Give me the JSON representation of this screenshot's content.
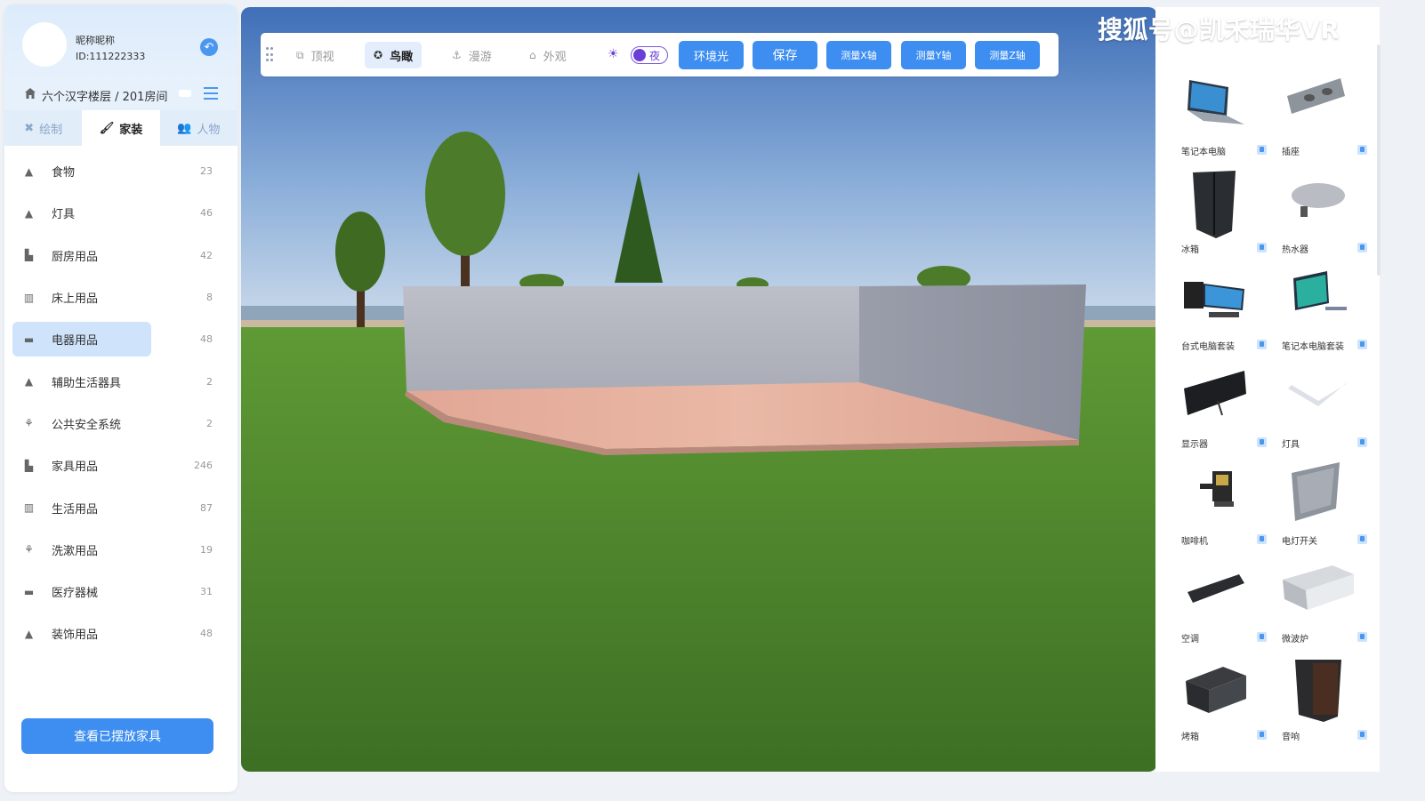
{
  "profile": {
    "nickname": "昵称昵称",
    "id": "ID:111222333"
  },
  "room": {
    "path": "六个汉字楼层 / 201房间"
  },
  "tabs": [
    {
      "label": "绘制",
      "icon": "tools-icon",
      "active": false
    },
    {
      "label": "家装",
      "icon": "paint-roller-icon",
      "active": true
    },
    {
      "label": "人物",
      "icon": "people-icon",
      "active": false
    }
  ],
  "categories": [
    {
      "label": "食物",
      "count": "23",
      "icon": "lamp-icon"
    },
    {
      "label": "灯具",
      "count": "46",
      "icon": "lamp-icon"
    },
    {
      "label": "厨房用品",
      "count": "42",
      "icon": "building-icon"
    },
    {
      "label": "床上用品",
      "count": "8",
      "icon": "bars-icon"
    },
    {
      "label": "电器用品",
      "count": "48",
      "icon": "device-icon",
      "active": true
    },
    {
      "label": "辅助生活器具",
      "count": "2",
      "icon": "lamp-icon"
    },
    {
      "label": "公共安全系统",
      "count": "2",
      "icon": "plant-icon"
    },
    {
      "label": "家具用品",
      "count": "246",
      "icon": "building-icon"
    },
    {
      "label": "生活用品",
      "count": "87",
      "icon": "bars-icon"
    },
    {
      "label": "洗漱用品",
      "count": "19",
      "icon": "plant-icon"
    },
    {
      "label": "医疗器械",
      "count": "31",
      "icon": "device-icon"
    },
    {
      "label": "装饰用品",
      "count": "48",
      "icon": "lamp-icon"
    }
  ],
  "view_placed_button": "查看已摆放家具",
  "toolbar": {
    "modes": [
      {
        "label": "顶视",
        "icon": "top-view-icon",
        "active": false
      },
      {
        "label": "鸟瞰",
        "icon": "birdseye-icon",
        "active": true
      },
      {
        "label": "漫游",
        "icon": "walk-icon",
        "active": false
      },
      {
        "label": "外观",
        "icon": "house-icon",
        "active": false
      }
    ],
    "night_label": "夜",
    "buttons": {
      "ambient": "环境光",
      "save": "保存",
      "measure_x": "测量X轴",
      "measure_y": "测量Y轴",
      "measure_z": "测量Z轴"
    }
  },
  "watermark": "搜狐号@凯禾瑞华VR",
  "items": [
    {
      "label": "笔记本电脑",
      "thumb": "laptop"
    },
    {
      "label": "插座",
      "thumb": "socket"
    },
    {
      "label": "冰箱",
      "thumb": "fridge"
    },
    {
      "label": "热水器",
      "thumb": "heater"
    },
    {
      "label": "台式电脑套装",
      "thumb": "desktop"
    },
    {
      "label": "笔记本电脑套装",
      "thumb": "laptop-set"
    },
    {
      "label": "显示器",
      "thumb": "monitor"
    },
    {
      "label": "灯具",
      "thumb": "lamp"
    },
    {
      "label": "咖啡机",
      "thumb": "coffee"
    },
    {
      "label": "电灯开关",
      "thumb": "switch"
    },
    {
      "label": "空调",
      "thumb": "ac"
    },
    {
      "label": "微波炉",
      "thumb": "microwave"
    },
    {
      "label": "烤箱",
      "thumb": "oven"
    },
    {
      "label": "音响",
      "thumb": "speaker"
    }
  ],
  "colors": {
    "accent": "#3d8ef0",
    "active_bg": "#cfe3fb",
    "night_purple": "#6a3fd8",
    "grass": "#4f8a2d",
    "sky": "#7da7d8"
  }
}
